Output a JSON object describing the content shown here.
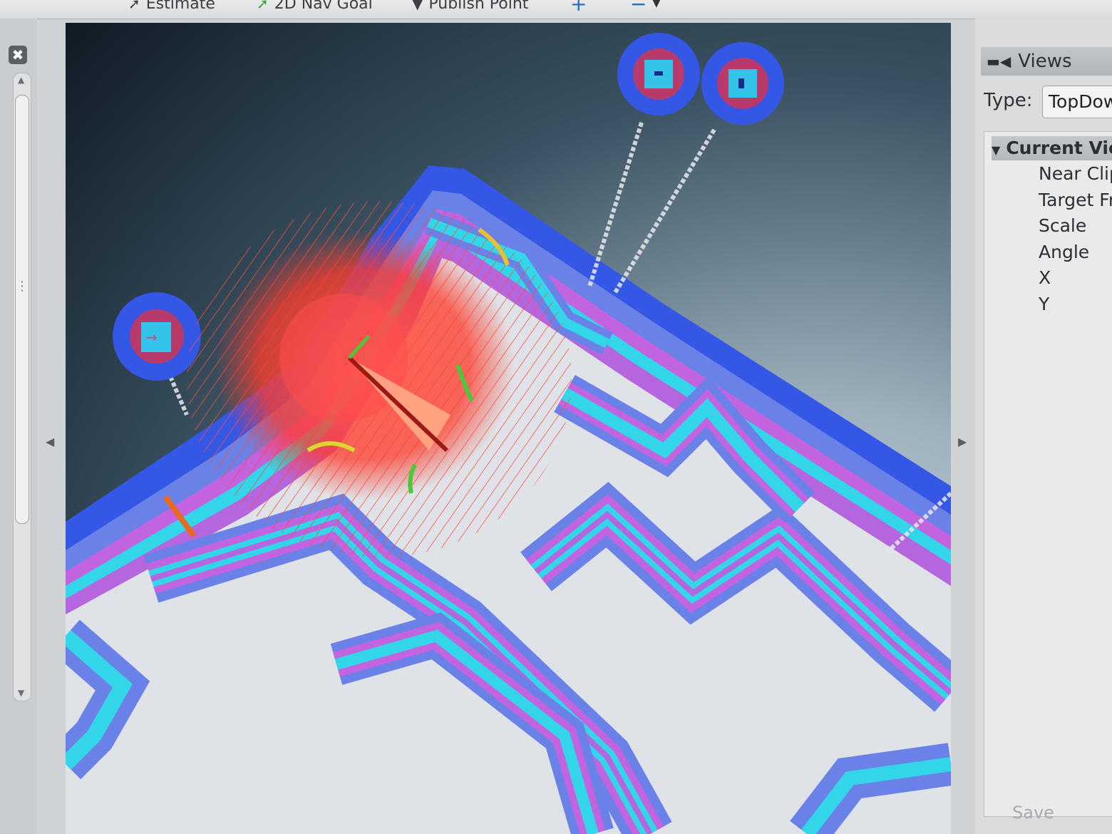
{
  "toolbar": {
    "items": [
      {
        "label": "Estimate",
        "icon": "arrow-icon"
      },
      {
        "label": "2D Nav Goal",
        "icon": "green-arrow-icon"
      },
      {
        "label": "Publish Point",
        "icon": "pin-icon"
      }
    ],
    "plus_icon": "+",
    "minus_icon": "−"
  },
  "left_panel": {
    "close_icon": "✖"
  },
  "views": {
    "title": "Views",
    "type_label": "Type:",
    "type_value": "TopDownOrtho",
    "current_view_label": "Current View",
    "properties": [
      "Near Clip",
      "Target Frame",
      "Scale",
      "Angle",
      "X",
      "Y"
    ],
    "save_label": "Save"
  },
  "colors": {
    "free_space": "#dfe3e8",
    "inflation_outer": "#3557e6",
    "inflation_mid": "#6a82e8",
    "lethal_cyan": "#33d6e8",
    "inscribed_magenta": "#c263e0",
    "particles": "#ff3a2a",
    "laser": "#e8e8ee",
    "background_dark": "#101a24"
  }
}
